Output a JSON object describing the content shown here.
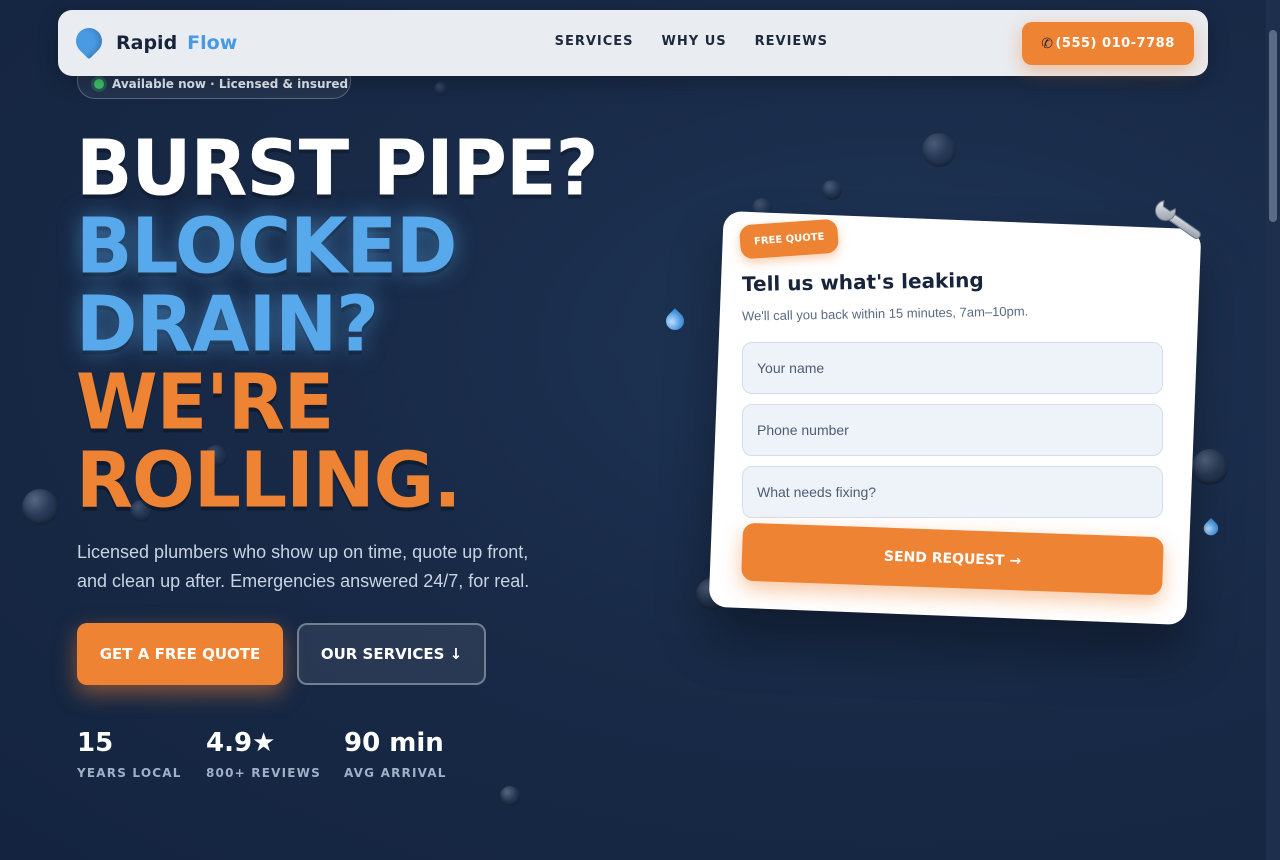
{
  "nav": {
    "logo_part1": "Rapid",
    "logo_part2": "Flow",
    "links": [
      "SERVICES",
      "WHY US",
      "REVIEWS"
    ],
    "phone_label": "(555) 010-7788"
  },
  "status_pill": {
    "text": "Available now · Licensed & insured"
  },
  "hero": {
    "line1": "BURST PIPE?",
    "line2": "BLOCKED",
    "line3": "DRAIN?",
    "line4": "WE'RE",
    "line5": "ROLLING.",
    "subtext": "Licensed plumbers who show up on time, quote up front, and clean up after. Emergencies answered 24/7, for real.",
    "cta_primary": "GET A FREE QUOTE",
    "cta_secondary": "OUR SERVICES ↓"
  },
  "stats": [
    {
      "value": "15",
      "label": "YEARS LOCAL"
    },
    {
      "value": "4.9★",
      "label": "800+ REVIEWS"
    },
    {
      "value": "90 min",
      "label": "AVG ARRIVAL"
    }
  ],
  "quote_card": {
    "badge": "FREE QUOTE",
    "title": "Tell us what's leaking",
    "subtitle": "We'll call you back within 15 minutes, 7am–10pm.",
    "name_placeholder": "Your name",
    "phone_placeholder": "Phone number",
    "issue_placeholder": "What needs fixing?",
    "submit_label": "SEND REQUEST →"
  },
  "colors": {
    "accent_orange": "#ef8334",
    "accent_blue": "#58a9ec",
    "background": "#182a47",
    "status_green": "#3cc46a"
  },
  "icons": [
    "water-drop-icon",
    "phone-icon",
    "wrench-icon"
  ]
}
